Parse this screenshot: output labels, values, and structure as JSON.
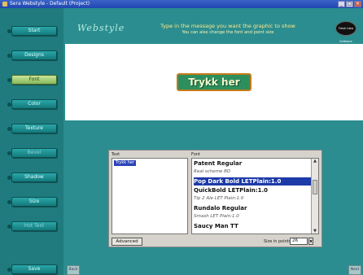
{
  "window": {
    "title": "Sera Webstyle - Default (Project)",
    "controls": [
      "_",
      "□",
      "×"
    ]
  },
  "sidebar": {
    "items": [
      {
        "label": "Start"
      },
      {
        "label": "Designs"
      },
      {
        "label": "Font"
      },
      {
        "label": "Color"
      },
      {
        "label": "Texture"
      },
      {
        "label": "Bevel"
      },
      {
        "label": "Shadow"
      },
      {
        "label": "Size"
      },
      {
        "label": "Hot Text"
      },
      {
        "label": "Save"
      }
    ]
  },
  "header": {
    "logo_text": "Webstyle",
    "instruction": "Type in the message you want the graphic to show",
    "instruction_sub": "You can also change the font and point size",
    "app_logo_text": "Fresh Idea Software"
  },
  "preview": {
    "graphic_text": "Trykk her"
  },
  "font_dialog": {
    "text_label": "Text",
    "text_value": "Trykk her",
    "font_label": "Font",
    "fonts": [
      {
        "name": "Patent Regular",
        "preview": "Real scheme BD"
      },
      {
        "name": "Pop Dark Bold LETPlain:1.0",
        "selected": true
      },
      {
        "name": "QuickBold LETPlain:1.0",
        "preview": "Tip 2 Ale LET Plain:1.0"
      },
      {
        "name": "Rundalo Regular",
        "preview": "Smash LET Plain:1.0"
      },
      {
        "name": "Saucy Man TT"
      }
    ],
    "advanced_label": "Advanced",
    "size_label": "Size in points",
    "size_value": "26"
  },
  "nav": {
    "back_label": "Back",
    "next_label": "Next"
  }
}
